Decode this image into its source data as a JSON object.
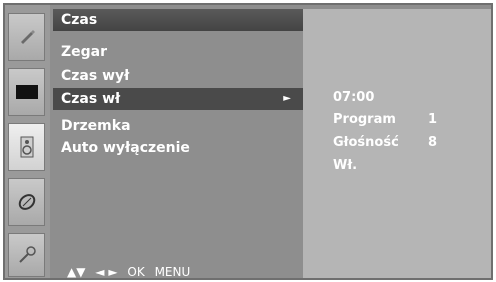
{
  "header": {
    "title": "Czas"
  },
  "icons": [
    "picture-icon",
    "screen-icon",
    "speaker-icon",
    "clock-icon",
    "key-icon"
  ],
  "menu": {
    "items": [
      {
        "label": "Zegar"
      },
      {
        "label": "Czas wył"
      },
      {
        "label": "Czas wł",
        "selected": true,
        "arrow": "►"
      },
      {
        "label": "Drzemka"
      },
      {
        "label": "Auto wyłączenie"
      }
    ]
  },
  "footer": {
    "updown": "▲▼",
    "leftright": "◄ ►",
    "ok": "OK",
    "menu": "MENU"
  },
  "info": {
    "time": "07:00",
    "program_label": "Program",
    "program_value": "1",
    "volume_label": "Głośność",
    "volume_value": "8",
    "state": "Wł."
  },
  "colors": {
    "panel": "#8e8e8e",
    "header": "#4f4f4f",
    "selected": "#4a4a4a",
    "info_panel": "#b5b5b5",
    "text": "#ffffff"
  }
}
